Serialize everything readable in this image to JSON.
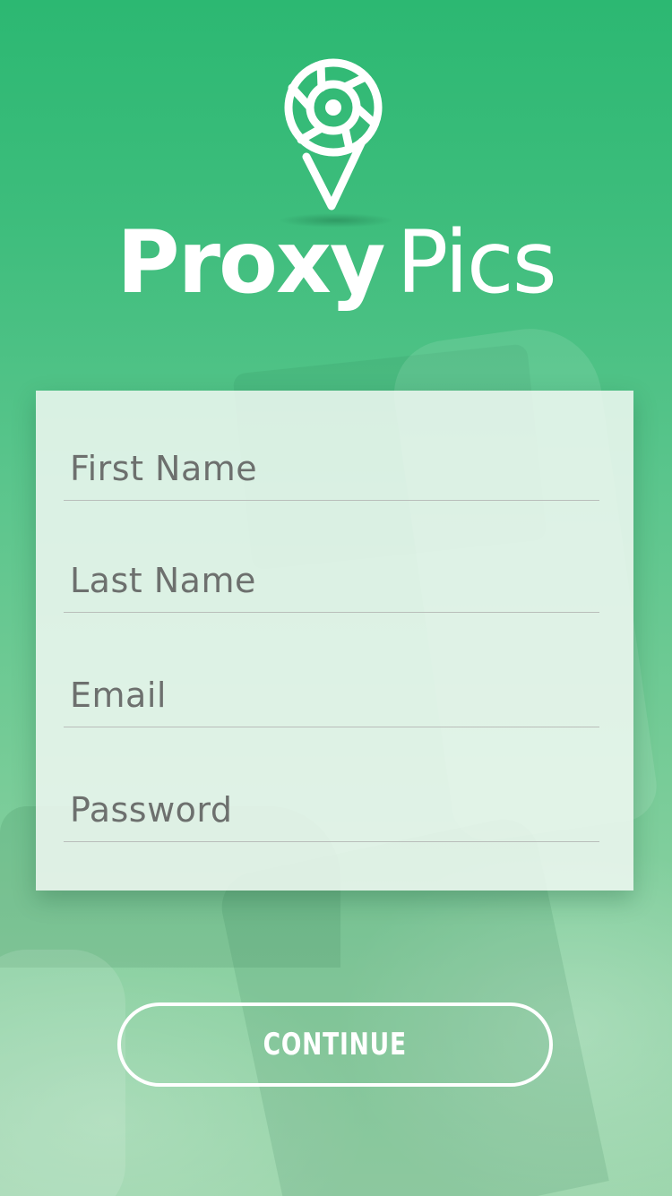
{
  "brand": {
    "name_bold": "Proxy",
    "name_light": "Pics",
    "logo_icon": "camera-aperture-pin-icon",
    "color": "#ffffff"
  },
  "theme": {
    "accent": "#2cb872",
    "field_text": "#6d706e",
    "divider": "#b9beba"
  },
  "form": {
    "first_name_placeholder": "First Name",
    "last_name_placeholder": "Last Name",
    "email_placeholder": "Email",
    "password_placeholder": "Password"
  },
  "actions": {
    "continue_label": "CONTINUE"
  }
}
